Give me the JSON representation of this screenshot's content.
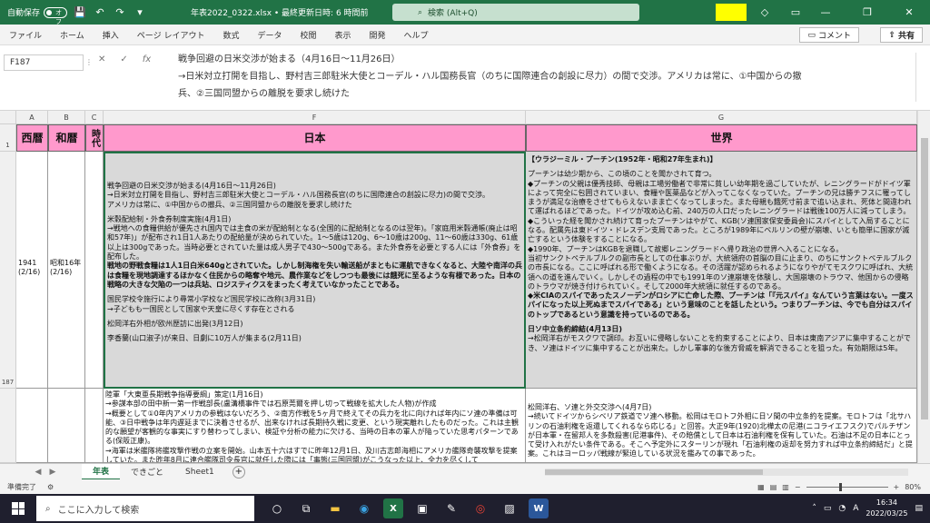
{
  "titlebar": {
    "autosave_label": "自動保存",
    "autosave_state": "オフ",
    "title": "年表2022_0322.xlsx • 最終更新日時: 6 時間前",
    "search_placeholder": "検索 (Alt+Q)",
    "brand_color": "#217346"
  },
  "ribbon": {
    "tabs": [
      "ファイル",
      "ホーム",
      "挿入",
      "ページ レイアウト",
      "数式",
      "データ",
      "校閲",
      "表示",
      "開発",
      "ヘルプ"
    ],
    "comment_label": "コメント",
    "share_label": "共有"
  },
  "formula": {
    "namebox": "F187",
    "fx": "fx",
    "lines": [
      "戦争回避の日米交渉が始まる（4月16日〜11月26日）",
      "→日米対立打開を目指し、野村吉三郎駐米大使とコーデル・ハル国務長官（のちに国際連合の創設に尽力）の間で交渉。アメリカは常に、①中国からの撤",
      "兵、②三国同盟からの離脱を要求し続けた"
    ]
  },
  "columns": [
    "A",
    "B",
    "C",
    "F",
    "G"
  ],
  "headers": {
    "a": "西暦",
    "b": "和暦",
    "c": "時代",
    "f": "日本",
    "g": "世界"
  },
  "rows": {
    "r1": "1",
    "r187": "187",
    "r188": ""
  },
  "cells": {
    "a187": "1941\n(2/16)",
    "b187": "昭和16年\n(2/16)",
    "f187": [
      "戦争回避の日米交渉が始まる(4月16日〜11月26日)",
      "→日米対立打開を目指し、野村吉三郎駐米大使とコーデル・ハル国務長官(のちに国際連合の創設に尽力)の間で交渉。",
      "アメリカは常に、①中国からの撤兵、②三国同盟からの離脱を要求し続けた",
      "",
      "米穀配給制・外食券制度実施(4月1日)",
      "→戦地への食糧供給が優先され国内では主食の米が配給制となる(全国的に配給制となるのは翌年)。「家庭用米穀通帳(廃止は昭和57年)」が配布され1日1人あたりの配給量が決められていた。1〜5歳は120g、6〜10歳は200g、11〜60歳は330g、61歳以上は300gであった。当時必要とされていた量は成人男子で430〜500gである。また外食券を必要とする人には「外食券」を配布した。",
      "戦地の野戦食糧は1人1日白米640gとされていた。しかし制海権を失い輸送船がまともに運航できなくなると、大陸や南洋の兵は食糧を現地調達するほかなく住民からの略奪や地元、農作業などをしつつも最後には餓死に至るような有様であった。日本の戦略の大きな欠陥の一つは兵站、ロジスティクスをまったく考えていなかったことである。",
      "",
      "国民学校令施行により尋常小学校など国民学校に改称(3月31日)",
      "→子どもも一国民として国家や天皇に尽くす存在とされる",
      "",
      "松岡洋右外相が欧州歴訪に出発(3月12日)",
      "",
      "李香蘭(山口淑子)が来日、日劇に10万人が集まる(2月11日)"
    ],
    "g187": [
      "【ウラジーミル・プーチン(1952年・昭和27年生まれ)】",
      "",
      "プーチンは幼少期から、この頃のことを聞かされて育つ。",
      "◆プーチンの父親は優秀技師、母親は工場労働者で非常に貧しい幼年期を過ごしていたが、レニングラードがドイツ軍によって完全に包囲されていまい、食糧や医薬品などが入ってこなくなっていた。プーチンの兄は勝チフスに罹ってしまうが満足な治療をさせてもらえないまま亡くなってしまった。また母親も餓死寸前まで追い込まれ、死体と間違われて運ばれるほどであった。ドイツが攻め込む前、240万の人口だったレニングラードは戦後100万人に減ってしまう。",
      "◆こういった経を聞かされ続けて育ったプーチンはやがて、KGB(ソ連国家保安委員会)にスパイとして入局することになる。配属先は東ドイツ・ドレスデン支局であった。ところが1989年にベルリンの壁が崩壊、いとも簡単に国家が滅亡するという体験をすることになる。",
      "◆1990年、プーチンはKGBを退職して故郷レニングラードへ帰り政治の世界へ入ることになる。",
      "当初サンクトペテルブルクの副市長としての仕事ぶりが、大統領府の首脳の目に止まり、のちにサンクトペテルブルクの市長になる。ここに呼ばれる形で働くようになる。その活躍が認められるようになりやがてモスクワに呼ばれ、大統領への道を進んでいく。しかしその過程の中でも1991年のソ連崩壊を体験し、大国崩壊のトラウマ、他国からの侵略のトラウマが焼き付けられていく。そして2000年大統領に就任するのである。",
      "◆米CIAのスパイであったスノーデンがロシアに亡命した際、プーチンは「『元スパイ』なんていう言葉はない。一度スパイになった以上死ぬまでスパイである」という意味のことを話したという。つまりプーチンは、今でも自分はスパイのトップであるという意識を持っているのである。",
      "",
      "日ソ中立条約締結(4月13日)",
      "→松岡洋右がモスクワで調印。お互いに侵略しないことを約束することにより、日本は東南アジアに集中することができ、ソ連はドイツに集中することが出来た。しかし軍事的な後方脅威を解消できることを狙った。有効期限は5年。"
    ],
    "f188": [
      "陸軍「大東亜長期戦争指導要綱」策定(1月16日)",
      "→参謀本部の田中新一第一作戦部長(盧溝橋事件では石原莞爾を押し切って戦線を拡大した人物)が作成",
      "→概要として①0年内アメリカの参戦はないだろう、②南方作戦を5ヶ月で終えてその兵力を北に向ければ年内にソ連の準備は可能、③日中戦争は年内遅延までに決着させるが、出来なければ長期持久戦に変更、という現実離れしたものだった。これは主観的な願望が客観的な事実にすり替わってしまい、検証や分析の能力に欠ける、当時の日本の軍人が陥っていた思考パターンである(保阪正康)。",
      "→海軍は米艦隊将艦攻撃作戦の立案を開始。山本五十六はすでに昨年12月1日、及川古志郎海相にアメリカ艦隊奇襲攻撃を提案していた。また昨年8月に連合艦隊司令長官に就任した際には「事態(三国同盟)がこうなった以上、全力を尽くして"
    ],
    "g188": [
      "",
      "松岡洋右、ソ連と外交交渉へ(4月7日)",
      "→続いてドイツからシベリア鉄道でソ連へ移動。松岡はモロトフ外相に日ソ間の中立条約を提案。モロトフは「北サハリンの石油利権を返還してくれるなら応じる」と回答。大正9年(1920)北樺太の尼港(ニコライエフスク)でパルチザンが日本軍・在留邦人を多数殺害(尼港事件)、その賠償として日本は石油利権を保有していた。石油は不足の日本にとって受け入れがたい条件である。そこへ予定外にスターリンが現れ「石油利権の返却を努力すれば中立条約締結だ」と提案。これはヨーロッパ戦線が緊迫している状況を鑑みての事であった。"
    ]
  },
  "sheets": {
    "tabs": [
      "年表",
      "できごと",
      "Sheet1"
    ],
    "active": "年表"
  },
  "status": {
    "ready": "準備完了",
    "zoom": "80%"
  },
  "taskbar": {
    "search_placeholder": "ここに入力して検索",
    "time": "16:34",
    "date": "2022/03/25",
    "ime": "A"
  }
}
